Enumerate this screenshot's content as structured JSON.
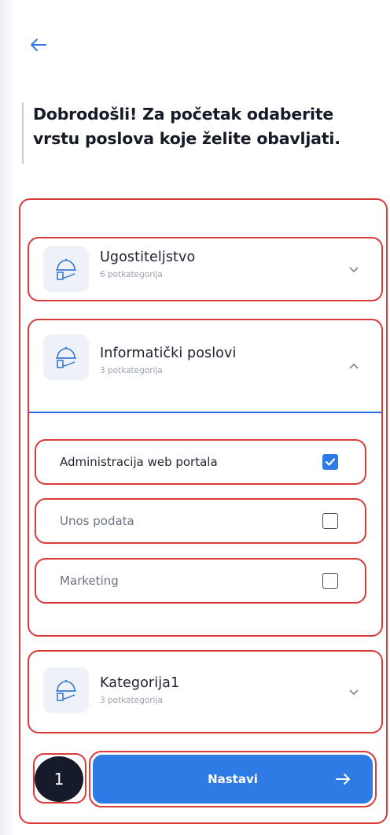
{
  "header": {
    "title": "Dobrodošli! Za početak odaberite vrstu poslova koje želite obavljati."
  },
  "categories": [
    {
      "title": "Ugostiteljstvo",
      "subtitle": "6 potkategorija",
      "expanded": false,
      "icon": "chef-hat-icon"
    },
    {
      "title": "Informatički poslovi",
      "subtitle": "3 potkategorija",
      "expanded": true,
      "icon": "chef-hat-icon"
    },
    {
      "title": "Kategorija1",
      "subtitle": "3 potkategorija",
      "expanded": false,
      "icon": "chef-hat-icon"
    }
  ],
  "subcategories": [
    {
      "label": "Administracija web portala",
      "checked": true
    },
    {
      "label": "Unos podata",
      "checked": false
    },
    {
      "label": "Marketing",
      "checked": false
    }
  ],
  "footer": {
    "counter": "1",
    "next_label": "Nastavi"
  },
  "colors": {
    "accent": "#2f7be6",
    "annotation_outline": "#d93a3a",
    "counter_bg": "#151b2b"
  }
}
